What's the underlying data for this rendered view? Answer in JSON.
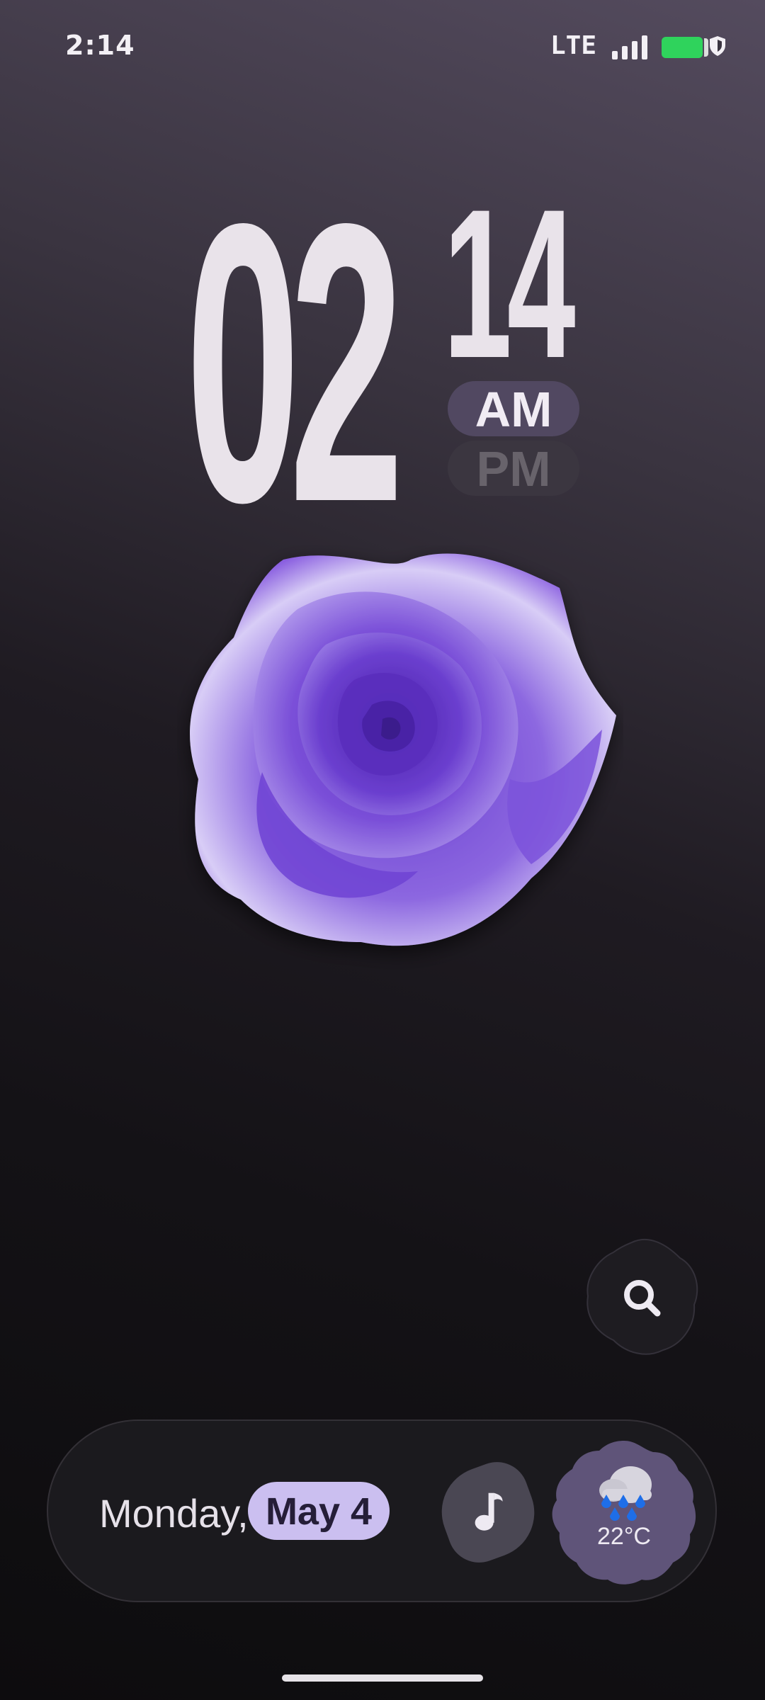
{
  "status_bar": {
    "time": "2:14",
    "network": "LTE",
    "signal_icon": "signal-bars-icon",
    "battery_icon": "battery-icon",
    "battery_color": "#2fd35c",
    "shield_icon": "shield-icon"
  },
  "clock": {
    "hours": "02",
    "minutes": "14",
    "am_label": "AM",
    "pm_label": "PM",
    "active_period": "AM"
  },
  "wallpaper": {
    "subject": "rose-icon",
    "accent": "#7b4fd6"
  },
  "search": {
    "icon": "search-icon"
  },
  "bottom_bar": {
    "weekday": "Monday,",
    "date": "May 4",
    "music_icon": "music-note-icon",
    "weather_icon": "rain-cloud-icon",
    "temperature": "22°C",
    "accent_color": "#cbbff0"
  }
}
